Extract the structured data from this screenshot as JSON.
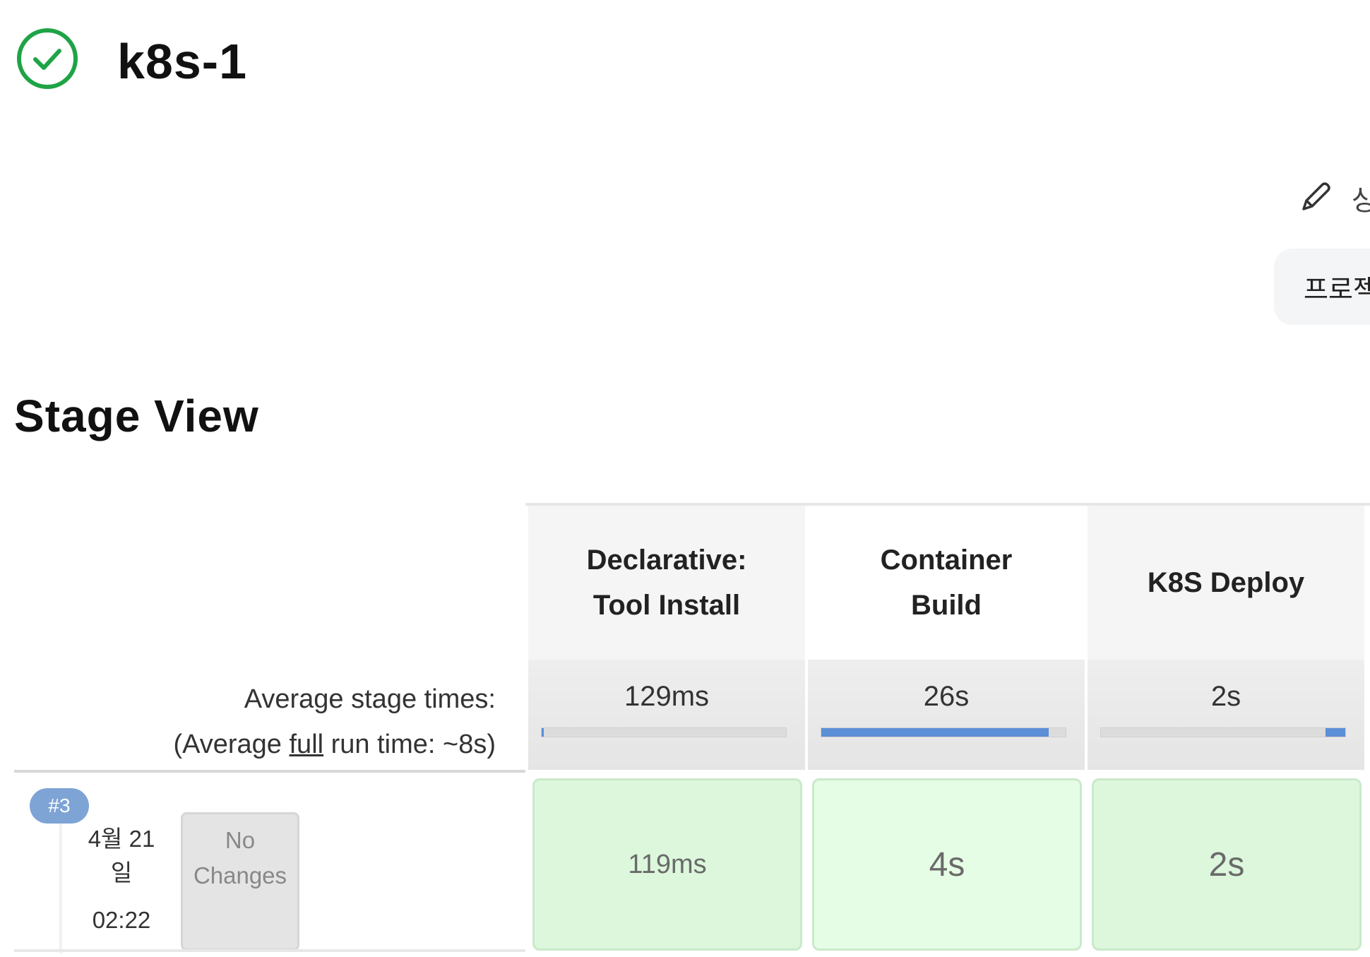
{
  "job": {
    "title": "k8s-1",
    "status": "success",
    "status_color": "#1ea446"
  },
  "actions": {
    "edit_label": "상",
    "project_label": "프로젝"
  },
  "stage_view": {
    "title": "Stage View",
    "stages": [
      {
        "name": "Declarative: Tool Install",
        "line1": "Declarative:",
        "line2": "Tool Install",
        "avg_time": "129ms",
        "avg_fill": [
          0.0,
          0.01
        ]
      },
      {
        "name": "Container Build",
        "line1": "Container",
        "line2": "Build",
        "avg_time": "26s",
        "avg_fill": [
          0.0,
          0.93
        ]
      },
      {
        "name": "K8S Deploy",
        "line1": "K8S Deploy",
        "line2": "",
        "avg_time": "2s",
        "avg_fill": [
          0.92,
          1.0
        ]
      }
    ],
    "avg_label_line1": "Average stage times:",
    "avg_label_prefix": "(Average ",
    "avg_label_full": "full",
    "avg_label_suffix": " run time: ~8s)",
    "builds": [
      {
        "number": "#3",
        "date_line1": "4월 21",
        "date_line2": "일",
        "time": "02:22",
        "changes_line1": "No",
        "changes_line2": "Changes",
        "stage_times": [
          "119ms",
          "4s",
          "2s"
        ]
      }
    ],
    "colors": {
      "success_cell": "#dcf7dc",
      "progress_fill": "#5b8fd6",
      "build_badge": "#7ea4d6"
    }
  }
}
